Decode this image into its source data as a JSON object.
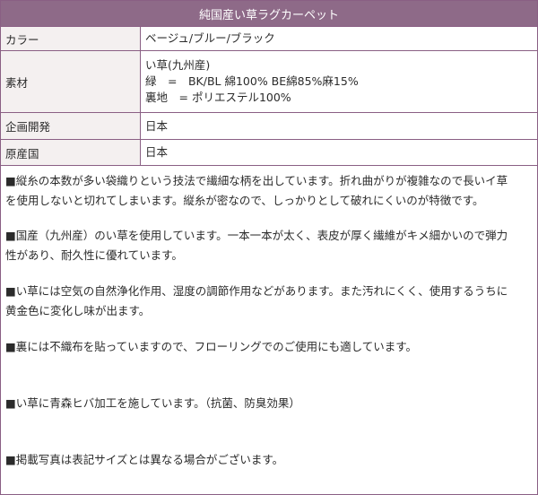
{
  "title": "純国産い草ラグカーペット",
  "spec_rows": [
    {
      "label": "カラー",
      "lines": [
        "ベージュ/ブルー/ブラック"
      ]
    },
    {
      "label": "素材",
      "lines": [
        "い草(九州産)",
        "緑　=　BK/BL 綿100% BE綿85%麻15%",
        "裏地　= ポリエステル100%"
      ]
    },
    {
      "label": "企画開発",
      "lines": [
        "日本"
      ]
    },
    {
      "label": "原産国",
      "lines": [
        "日本"
      ]
    }
  ],
  "notes": [
    [
      "■縦糸の本数が多い袋織りという技法で繊細な柄を出しています。折れ曲がりが複雑なので長いイ草",
      "を使用しないと切れてしまいます。縦糸が密なので、しっかりとして破れにくいのが特徴です。"
    ],
    [
      "■国産（九州産）のい草を使用しています。一本一本が太く、表皮が厚く繊維がキメ細かいので弾力",
      "性があり、耐久性に優れています。"
    ],
    [
      "■い草には空気の自然浄化作用、湿度の調節作用などがあります。また汚れにくく、使用するうちに",
      "黄金色に変化し味が出ます。"
    ],
    [
      "■裏には不織布を貼っていますので、フローリングでのご使用にも適しています。"
    ],
    [
      "■い草に青森ヒバ加工を施しています。（抗菌、防臭効果）"
    ],
    [
      "■掲載写真は表記サイズとは異なる場合がございます。"
    ]
  ],
  "colors": {
    "header_bg": "#8e6a88",
    "border": "#8a5f84",
    "label_bg": "#f4f0f0"
  }
}
